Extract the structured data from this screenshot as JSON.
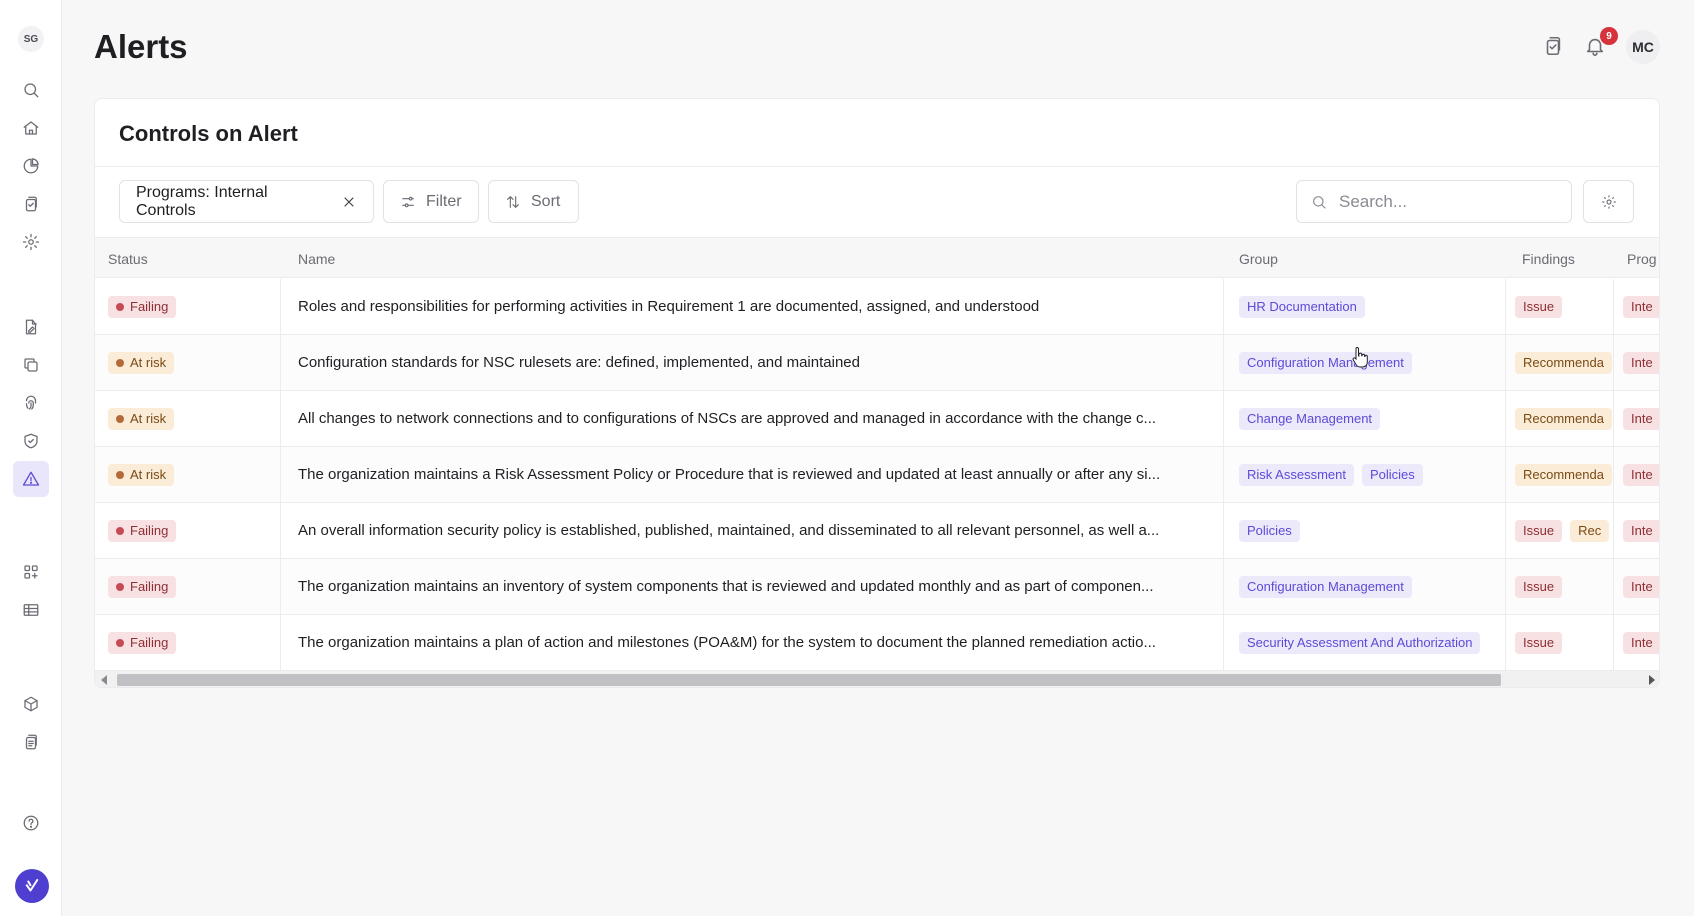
{
  "sidebar": {
    "org_initials": "SG",
    "items": [
      {
        "icon": "search-icon"
      },
      {
        "icon": "home-icon"
      },
      {
        "icon": "pie-chart-icon"
      },
      {
        "icon": "clipboard-copy-icon"
      },
      {
        "icon": "gear-icon"
      },
      {
        "icon": "document-edit-icon"
      },
      {
        "icon": "layers-icon"
      },
      {
        "icon": "fingerprint-icon"
      },
      {
        "icon": "shield-check-icon"
      },
      {
        "icon": "alert-triangle-icon",
        "active": true
      },
      {
        "icon": "grid-plus-icon"
      },
      {
        "icon": "table-icon"
      },
      {
        "icon": "cube-icon"
      },
      {
        "icon": "clipboard-list-icon"
      },
      {
        "icon": "help-circle-icon"
      }
    ]
  },
  "header": {
    "title": "Alerts",
    "notification_count": "9",
    "user_initials": "MC"
  },
  "card": {
    "title": "Controls on Alert",
    "filter_chip": "Programs: Internal Controls",
    "filter_label": "Filter",
    "sort_label": "Sort",
    "search_placeholder": "Search..."
  },
  "table": {
    "columns": {
      "status": "Status",
      "name": "Name",
      "group": "Group",
      "findings": "Findings",
      "program": "Prog"
    },
    "rows": [
      {
        "status": "Failing",
        "name": "Roles and responsibilities for performing activities in Requirement 1 are documented, assigned, and understood",
        "groups": [
          "HR Documentation"
        ],
        "findings": [
          "Issue"
        ],
        "program": "Inte"
      },
      {
        "status": "At risk",
        "name": "Configuration standards for NSC rulesets are: defined, implemented, and maintained",
        "groups": [
          "Configuration Management"
        ],
        "findings": [
          "Recommenda"
        ],
        "program": "Inte"
      },
      {
        "status": "At risk",
        "name": "All changes to network connections and to configurations of NSCs are approved and managed in accordance with the change c...",
        "groups": [
          "Change Management"
        ],
        "findings": [
          "Recommenda"
        ],
        "program": "Inte"
      },
      {
        "status": "At risk",
        "name": "The organization maintains a Risk Assessment Policy or Procedure that is reviewed and updated at least annually or after any si...",
        "groups": [
          "Risk Assessment",
          "Policies"
        ],
        "findings": [
          "Recommenda"
        ],
        "program": "Inte"
      },
      {
        "status": "Failing",
        "name": "An overall information security policy is established, published, maintained, and disseminated to all relevant personnel, as well a...",
        "groups": [
          "Policies"
        ],
        "findings": [
          "Issue",
          "Rec"
        ],
        "program": "Inte"
      },
      {
        "status": "Failing",
        "name": "The organization maintains an inventory of system components that is reviewed and updated monthly and as part of componen...",
        "groups": [
          "Configuration Management"
        ],
        "findings": [
          "Issue"
        ],
        "program": "Inte"
      },
      {
        "status": "Failing",
        "name": "The organization maintains a plan of action and milestones (POA&M) for the system to document the planned remediation actio...",
        "groups": [
          "Security Assessment And Authorization"
        ],
        "findings": [
          "Issue"
        ],
        "program": "Inte"
      }
    ]
  },
  "colors": {
    "accent": "#5b4bd6",
    "failing": "#c54b53",
    "at_risk": "#b56a3b",
    "notification": "#d6333a"
  }
}
